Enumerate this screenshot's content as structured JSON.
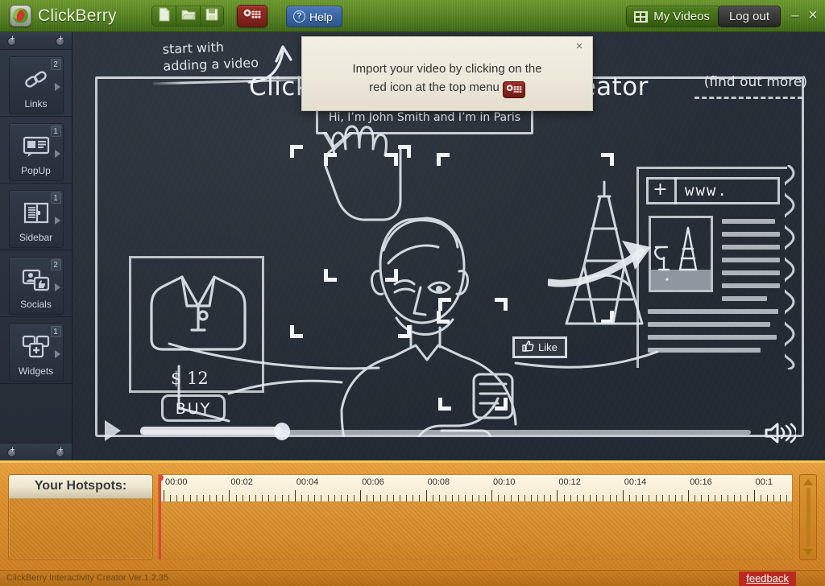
{
  "app": {
    "brand": "ClickBerry",
    "status_text": "ClickBerry Interactivity Creator Ver.1.2.35",
    "feedback_label": "feedback"
  },
  "topbar": {
    "new_label": "new-document",
    "open_label": "open-folder",
    "save_label": "save-disk",
    "import_video_label": "import-video",
    "help_label": "Help",
    "help_glyph": "?",
    "my_videos_label": "My Videos",
    "logout_label": "Log out",
    "minimize_glyph": "–",
    "close_glyph": "×"
  },
  "sidebar": {
    "items": [
      {
        "label": "Links",
        "badge": "2",
        "icon": "chain-link-icon"
      },
      {
        "label": "PopUp",
        "badge": "1",
        "icon": "popup-window-icon"
      },
      {
        "label": "Sidebar",
        "badge": "1",
        "icon": "sidebar-panel-icon"
      },
      {
        "label": "Socials",
        "badge": "2",
        "icon": "social-thumbsup-icon"
      },
      {
        "label": "Widgets",
        "badge": "1",
        "icon": "widgets-plus-icon"
      }
    ],
    "collapse_glyph": "+"
  },
  "board": {
    "hint_line1": "start with",
    "hint_line2": "adding a video",
    "title": "ClickBerry Interactivity Creator",
    "find_out_more": "(find out more)",
    "speech_bubble": "Hi, I’m John Smith and I’m in Paris",
    "product_price": "$ 12",
    "buy_label": "BUY",
    "like_label": "Like",
    "url_plus": "+",
    "url_text": "www.",
    "play_label": "play",
    "volume_label": "volume"
  },
  "tooltip": {
    "line1": "Import your video by clicking on the",
    "line2": "red icon at the top menu",
    "close_glyph": "×"
  },
  "timeline": {
    "hotspots_title": "Your Hotspots:",
    "ruler_labels": [
      "00:00",
      "00:02",
      "00:04",
      "00:06",
      "00:08",
      "00:10",
      "00:12",
      "00:14",
      "00:16",
      "00:1"
    ],
    "playhead_time": "00:00",
    "seconds_per_label": 2,
    "total_visible_seconds": 17
  },
  "colors": {
    "topbar_green": "#5f8a26",
    "chalkboard": "#2b333d",
    "timeline_orange": "#dd8f2c",
    "accent_red": "#bb2a21",
    "playhead_red": "#e8423a",
    "help_blue": "#2d548c"
  }
}
